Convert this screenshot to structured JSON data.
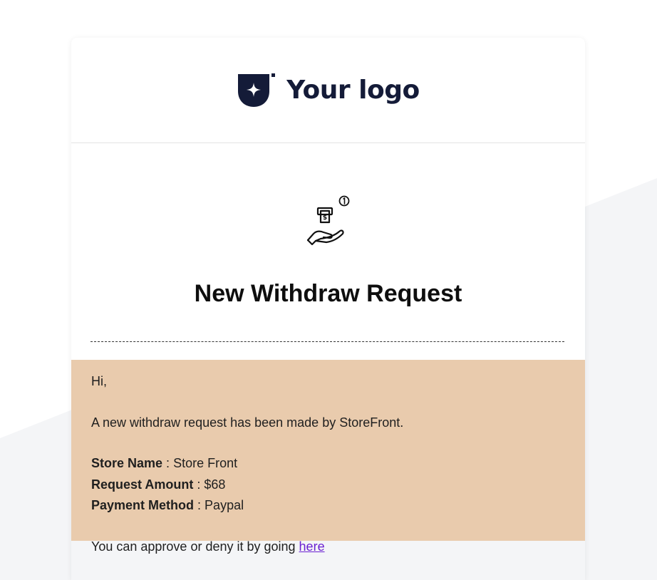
{
  "logo": {
    "text": "Your logo"
  },
  "email": {
    "title": "New Withdraw Request",
    "greeting": "Hi,",
    "intro": "A new withdraw request has been made by StoreFront.",
    "fields": [
      {
        "label": "Store Name",
        "separator": " : ",
        "value": "Store Front"
      },
      {
        "label": "Request Amount",
        "separator": " : ",
        "value": "$68"
      },
      {
        "label": "Payment Method",
        "separator": " : ",
        "value": "Paypal"
      }
    ],
    "cta_text": "You can approve or deny it by going ",
    "cta_link": "here"
  },
  "colors": {
    "logo": "#141b38",
    "body_bg": "#e9cbad",
    "link": "#6a1fd1",
    "page_bg": "#f4f5f7"
  },
  "icons": {
    "hero": "hand-money-icon",
    "logo": "logo-mark-icon"
  }
}
